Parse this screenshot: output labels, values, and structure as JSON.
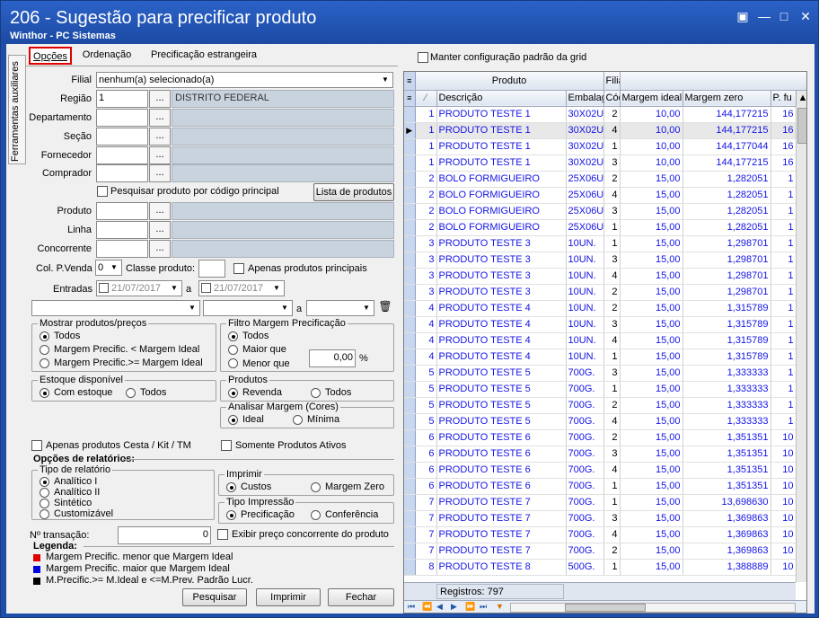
{
  "window": {
    "title": "206 - Sugestão para precificar produto",
    "subtitle": "Winthor - PC Sistemas"
  },
  "side_tab": "Ferramentas auxiliares",
  "tabs": [
    "Opções",
    "Ordenação",
    "Precificação estrangeira"
  ],
  "form": {
    "filial_label": "Filial",
    "filial_value": "nenhum(a) selecionado(a)",
    "regiao_label": "Região",
    "regiao_code": "1",
    "regiao_desc": "DISTRITO FEDERAL",
    "departamento_label": "Departamento",
    "secao_label": "Seção",
    "fornecedor_label": "Fornecedor",
    "comprador_label": "Comprador",
    "pesquisar_codigo": "Pesquisar produto por código principal",
    "lista_produtos": "Lista de produtos",
    "produto_label": "Produto",
    "linha_label": "Linha",
    "concorrente_label": "Concorrente",
    "col_pvenda_label": "Col. P.Venda",
    "col_pvenda_value": "0",
    "classe_label": "Classe produto:",
    "apenas_principais": "Apenas produtos principais",
    "entradas_label": "Entradas",
    "data_ini": "21/07/2017",
    "data_sep": "a",
    "data_fim": "21/07/2017",
    "range_sep": "a",
    "dots": "..."
  },
  "mostrar": {
    "title": "Mostrar produtos/preços",
    "options": [
      "Todos",
      "Margem Precific. < Margem Ideal",
      "Margem Precific.>= Margem Ideal"
    ]
  },
  "filtro": {
    "title": "Filtro Margem  Precificação",
    "options": [
      "Todos",
      "Maior que",
      "Menor que"
    ],
    "value": "0,00",
    "unit": "%"
  },
  "estoque": {
    "title": "Estoque disponível",
    "options": [
      "Com estoque",
      "Todos"
    ]
  },
  "produtos": {
    "title": "Produtos",
    "options": [
      "Revenda",
      "Todos"
    ]
  },
  "analisar": {
    "title": "Analisar Margem (Cores)",
    "options": [
      "Ideal",
      "Mínima"
    ]
  },
  "apenas_cesta": "Apenas produtos Cesta / Kit / TM",
  "somente_ativos": "Somente Produtos Ativos",
  "opcoes_relatorios": "Opções de relatórios:",
  "tipo_relatorio": {
    "title": "Tipo de relatório",
    "options": [
      "Analítico I",
      "Analítico II",
      "Sintético",
      "Customizável"
    ]
  },
  "imprimir_grp": {
    "title": "Imprimir",
    "options": [
      "Custos",
      "Margem Zero"
    ]
  },
  "tipo_impressao": {
    "title": "Tipo Impressão",
    "options": [
      "Precificação",
      "Conferência"
    ]
  },
  "transacao_label": "Nº transação:",
  "transacao_value": "0",
  "exibir_concorrente": "Exibir preço concorrente do produto",
  "legenda": {
    "title": "Legenda:",
    "items": [
      {
        "color": "#e00000",
        "text": "Margem Precific. menor que Margem Ideal"
      },
      {
        "color": "#0000e0",
        "text": "Margem Precific.  maior que Margem Ideal"
      },
      {
        "color": "#000000",
        "text": "M.Precific.>= M.Ideal e <=M.Prev. Padrão Lucr."
      }
    ]
  },
  "buttons": {
    "pesquisar": "Pesquisar",
    "imprimir": "Imprimir",
    "fechar": "Fechar"
  },
  "grid": {
    "manter_config": "Manter configuração padrão da grid",
    "group_headers": [
      "Produto",
      "Filia"
    ],
    "columns": [
      "Descrição",
      "Embalag",
      "Cód",
      "Margem ideal",
      "Margem zero",
      "P. fu"
    ],
    "rows": [
      [
        "1",
        "PRODUTO TESTE 1",
        "30X02U",
        "2",
        "10,00",
        "144,177215",
        "16"
      ],
      [
        "1",
        "PRODUTO TESTE 1",
        "30X02U",
        "4",
        "10,00",
        "144,177215",
        "16"
      ],
      [
        "1",
        "PRODUTO TESTE 1",
        "30X02U",
        "1",
        "10,00",
        "144,177044",
        "16"
      ],
      [
        "1",
        "PRODUTO TESTE 1",
        "30X02U",
        "3",
        "10,00",
        "144,177215",
        "16"
      ],
      [
        "2",
        "BOLO FORMIGUEIRO",
        "25X06U",
        "2",
        "15,00",
        "1,282051",
        "1"
      ],
      [
        "2",
        "BOLO FORMIGUEIRO",
        "25X06U",
        "4",
        "15,00",
        "1,282051",
        "1"
      ],
      [
        "2",
        "BOLO FORMIGUEIRO",
        "25X06U",
        "3",
        "15,00",
        "1,282051",
        "1"
      ],
      [
        "2",
        "BOLO FORMIGUEIRO",
        "25X06U",
        "1",
        "15,00",
        "1,282051",
        "1"
      ],
      [
        "3",
        "PRODUTO TESTE 3",
        "10UN.",
        "1",
        "15,00",
        "1,298701",
        "1"
      ],
      [
        "3",
        "PRODUTO TESTE 3",
        "10UN.",
        "3",
        "15,00",
        "1,298701",
        "1"
      ],
      [
        "3",
        "PRODUTO TESTE 3",
        "10UN.",
        "4",
        "15,00",
        "1,298701",
        "1"
      ],
      [
        "3",
        "PRODUTO TESTE 3",
        "10UN.",
        "2",
        "15,00",
        "1,298701",
        "1"
      ],
      [
        "4",
        "PRODUTO TESTE 4",
        "10UN.",
        "2",
        "15,00",
        "1,315789",
        "1"
      ],
      [
        "4",
        "PRODUTO TESTE 4",
        "10UN.",
        "3",
        "15,00",
        "1,315789",
        "1"
      ],
      [
        "4",
        "PRODUTO TESTE 4",
        "10UN.",
        "4",
        "15,00",
        "1,315789",
        "1"
      ],
      [
        "4",
        "PRODUTO TESTE 4",
        "10UN.",
        "1",
        "15,00",
        "1,315789",
        "1"
      ],
      [
        "5",
        "PRODUTO TESTE 5",
        "700G.",
        "3",
        "15,00",
        "1,333333",
        "1"
      ],
      [
        "5",
        "PRODUTO TESTE 5",
        "700G.",
        "1",
        "15,00",
        "1,333333",
        "1"
      ],
      [
        "5",
        "PRODUTO TESTE 5",
        "700G.",
        "2",
        "15,00",
        "1,333333",
        "1"
      ],
      [
        "5",
        "PRODUTO TESTE 5",
        "700G.",
        "4",
        "15,00",
        "1,333333",
        "1"
      ],
      [
        "6",
        "PRODUTO TESTE 6",
        "700G.",
        "2",
        "15,00",
        "1,351351",
        "10"
      ],
      [
        "6",
        "PRODUTO TESTE 6",
        "700G.",
        "3",
        "15,00",
        "1,351351",
        "10"
      ],
      [
        "6",
        "PRODUTO TESTE 6",
        "700G.",
        "4",
        "15,00",
        "1,351351",
        "10"
      ],
      [
        "6",
        "PRODUTO TESTE 6",
        "700G.",
        "1",
        "15,00",
        "1,351351",
        "10"
      ],
      [
        "7",
        "PRODUTO TESTE 7",
        "700G.",
        "1",
        "15,00",
        "13,698630",
        "10"
      ],
      [
        "7",
        "PRODUTO TESTE 7",
        "700G.",
        "3",
        "15,00",
        "1,369863",
        "10"
      ],
      [
        "7",
        "PRODUTO TESTE 7",
        "700G.",
        "4",
        "15,00",
        "1,369863",
        "10"
      ],
      [
        "7",
        "PRODUTO TESTE 7",
        "700G.",
        "2",
        "15,00",
        "1,369863",
        "10"
      ],
      [
        "8",
        "PRODUTO TESTE 8",
        "500G.",
        "1",
        "15,00",
        "1,388889",
        "10"
      ]
    ],
    "selected_row": 1,
    "registros": "Registros: 797"
  },
  "colors": {
    "title_bar": "#1f4ea8",
    "highlight_tab": "#e00000",
    "grid_text": "#1414e6"
  }
}
